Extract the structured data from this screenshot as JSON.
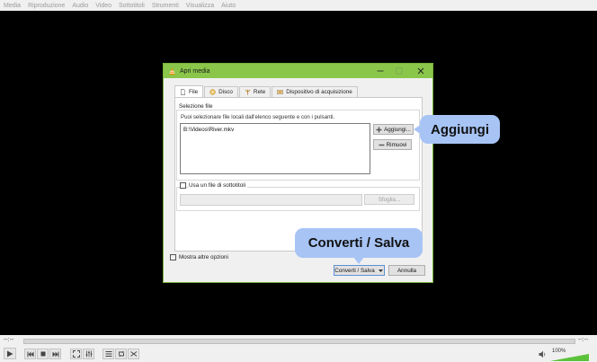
{
  "menu": [
    "Media",
    "Riproduzione",
    "Audio",
    "Video",
    "Sottotitoli",
    "Strumenti",
    "Visualizza",
    "Aiuto"
  ],
  "dialog": {
    "title": "Apri media",
    "tabs": [
      {
        "label": "File",
        "icon": "file-icon"
      },
      {
        "label": "Disco",
        "icon": "disc-icon"
      },
      {
        "label": "Rete",
        "icon": "network-icon"
      },
      {
        "label": "Dispositivo di acquisizione",
        "icon": "capture-device-icon"
      }
    ],
    "file_selection": {
      "group_label": "Selezione file",
      "description": "Puoi selezionare file locali dall'elenco seguente e con i pulsanti.",
      "files": [
        "B:\\Videos\\River.mkv"
      ],
      "add_label": "Aggiungi...",
      "remove_label": "Rimuovi"
    },
    "subtitles": {
      "checkbox_label": "Usa un file di sottotitoli",
      "browse_label": "Sfoglia..."
    },
    "more_options_label": "Mostra altre opzioni",
    "convert_label": "Converti / Salva",
    "cancel_label": "Annulla"
  },
  "callouts": {
    "add": "Aggiungi",
    "convert": "Converti / Salva"
  },
  "player": {
    "time_elapsed": "--:--",
    "time_total": "--:--",
    "volume_label": "100%",
    "volume_level": 1.0,
    "accent": "#8ac64a"
  }
}
